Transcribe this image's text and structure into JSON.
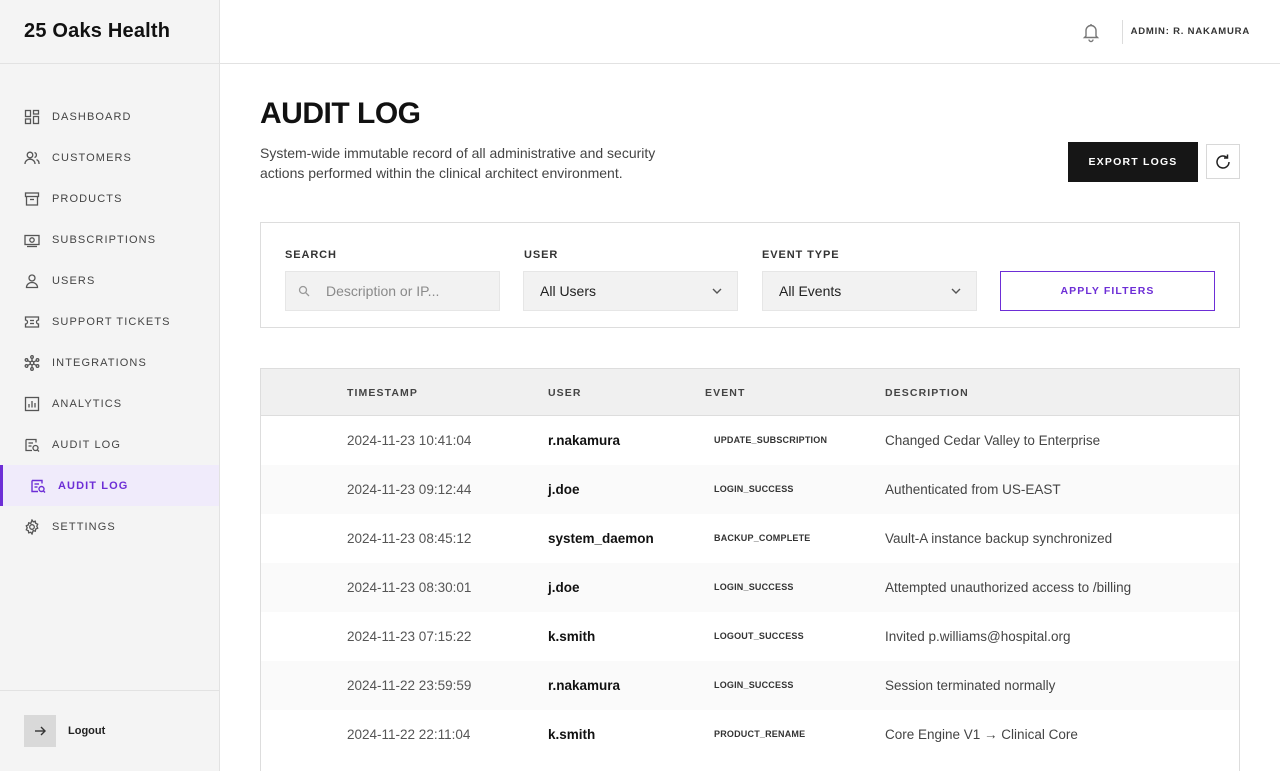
{
  "brand": {
    "name": "25 Oaks Health"
  },
  "sidebar": {
    "items": [
      {
        "label": "DASHBOARD",
        "icon": "dashboard-icon"
      },
      {
        "label": "CUSTOMERS",
        "icon": "customers-icon"
      },
      {
        "label": "PRODUCTS",
        "icon": "products-icon"
      },
      {
        "label": "SUBSCRIPTIONS",
        "icon": "subscriptions-icon"
      },
      {
        "label": "USERS",
        "icon": "user-icon"
      },
      {
        "label": "SUPPORT TICKETS",
        "icon": "ticket-icon"
      },
      {
        "label": "INTEGRATIONS",
        "icon": "integrations-icon"
      },
      {
        "label": "ANALYTICS",
        "icon": "analytics-icon"
      },
      {
        "label": "AUDIT LOG",
        "icon": "audit-log-icon"
      },
      {
        "label": "AUDIT LOG",
        "icon": "audit-log-icon",
        "active": true
      },
      {
        "label": "SETTINGS",
        "icon": "gear-icon"
      }
    ],
    "logout_label": "Logout"
  },
  "header": {
    "admin_label": "ADMIN: R. NAKAMURA"
  },
  "page": {
    "title": "AUDIT LOG",
    "description": "System-wide immutable record of all administrative and security actions performed within the clinical architect environment.",
    "export_label": "EXPORT LOGS"
  },
  "filters": {
    "search_label": "SEARCH",
    "search_placeholder": "Description or IP...",
    "user_label": "USER",
    "user_value": "All Users",
    "event_label": "EVENT TYPE",
    "event_value": "All Events",
    "apply_label": "APPLY FILTERS"
  },
  "table": {
    "headers": {
      "timestamp": "TIMESTAMP",
      "user": "USER",
      "event": "EVENT",
      "description": "DESCRIPTION"
    },
    "rows": [
      {
        "timestamp": "2024-11-23 10:41:04",
        "user": "r.nakamura",
        "event": "UPDATE_SUBSCRIPTION",
        "description": "Changed Cedar Valley to Enterprise"
      },
      {
        "timestamp": "2024-11-23 09:12:44",
        "user": "j.doe",
        "event": "LOGIN_SUCCESS",
        "description": "Authenticated from US-EAST"
      },
      {
        "timestamp": "2024-11-23 08:45:12",
        "user": "system_daemon",
        "event": "BACKUP_COMPLETE",
        "description": "Vault-A instance backup synchronized"
      },
      {
        "timestamp": "2024-11-23 08:30:01",
        "user": "j.doe",
        "event": "LOGIN_SUCCESS",
        "description": "Attempted unauthorized access to /billing"
      },
      {
        "timestamp": "2024-11-23 07:15:22",
        "user": "k.smith",
        "event": "LOGOUT_SUCCESS",
        "description": "Invited p.williams@hospital.org"
      },
      {
        "timestamp": "2024-11-22 23:59:59",
        "user": "r.nakamura",
        "event": "LOGIN_SUCCESS",
        "description": "Session terminated normally"
      },
      {
        "timestamp": "2024-11-22 22:11:04",
        "user": "k.smith",
        "event": "PRODUCT_RENAME",
        "description": "Core Engine V1 → Clinical Core"
      }
    ]
  },
  "colors": {
    "accent": "#6d2ed6",
    "dark_button": "#161616",
    "sidebar_bg": "#f4f4f4"
  }
}
